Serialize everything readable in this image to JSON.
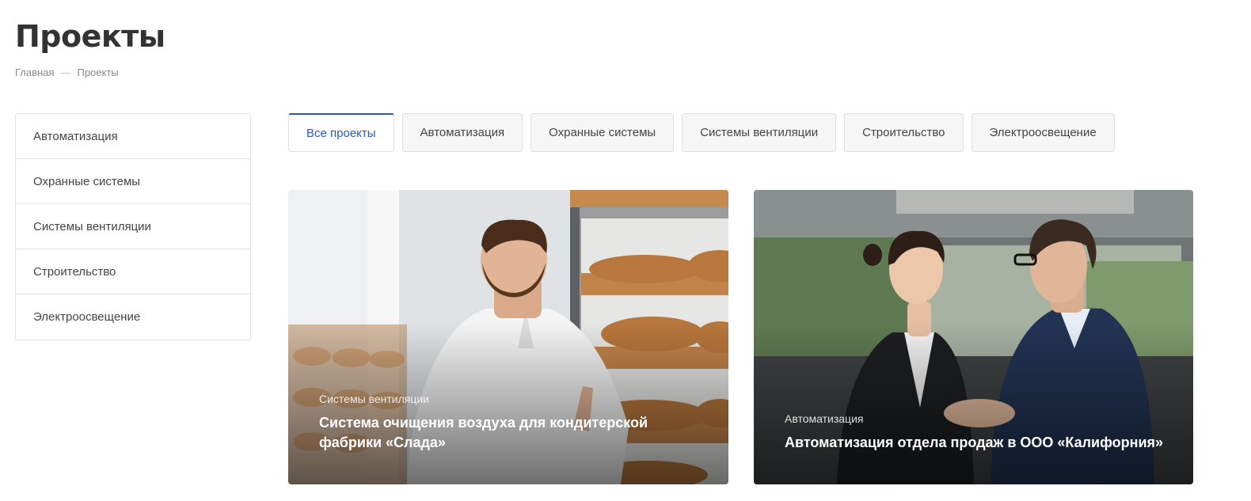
{
  "page": {
    "title": "Проекты",
    "breadcrumb": {
      "home": "Главная",
      "separator": "—",
      "current": "Проекты"
    }
  },
  "sidebar": {
    "items": [
      {
        "label": "Автоматизация"
      },
      {
        "label": "Охранные системы"
      },
      {
        "label": "Системы вентиляции"
      },
      {
        "label": "Строительство"
      },
      {
        "label": "Электроосвещение"
      }
    ]
  },
  "tabs": [
    {
      "label": "Все проекты",
      "active": true
    },
    {
      "label": "Автоматизация"
    },
    {
      "label": "Охранные системы"
    },
    {
      "label": "Системы вентиляции"
    },
    {
      "label": "Строительство"
    },
    {
      "label": "Электроосвещение"
    }
  ],
  "projects": [
    {
      "category": "Системы вентиляции",
      "title": "Система очищения воздуха для кондитерской фабрики «Слада»",
      "image": "baker-with-bread-rack-photo"
    },
    {
      "category": "Автоматизация",
      "title": "Автоматизация отдела продаж в ООО «Калифорния»",
      "image": "business-handshake-photo"
    }
  ],
  "colors": {
    "accent": "#2e55c6",
    "text": "#333333",
    "border": "#e3e3e3"
  }
}
